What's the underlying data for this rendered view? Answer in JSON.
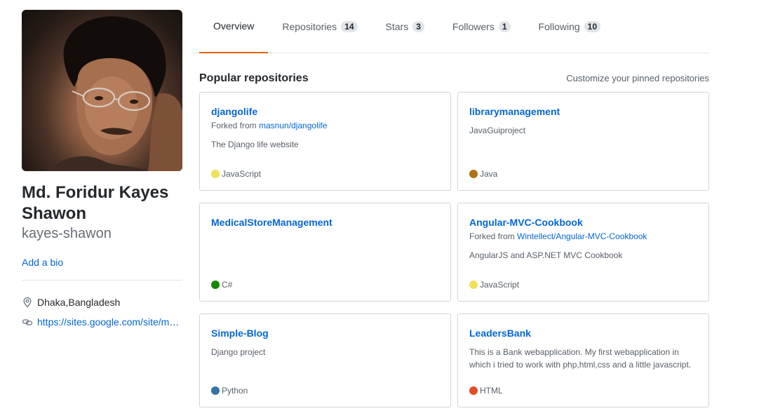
{
  "profile": {
    "name": "Md. Foridur Kayes Shawon",
    "login": "kayes-shawon",
    "add_bio": "Add a bio",
    "location": "Dhaka,Bangladesh",
    "website": "https://sites.google.com/site/m…"
  },
  "tabs": [
    {
      "label": "Overview",
      "count": null,
      "selected": true
    },
    {
      "label": "Repositories",
      "count": "14",
      "selected": false
    },
    {
      "label": "Stars",
      "count": "3",
      "selected": false
    },
    {
      "label": "Followers",
      "count": "1",
      "selected": false
    },
    {
      "label": "Following",
      "count": "10",
      "selected": false
    }
  ],
  "popular": {
    "title": "Popular repositories",
    "customize": "Customize your pinned repositories"
  },
  "repos": [
    {
      "name": "djangolife",
      "forked_prefix": "Forked from ",
      "forked_from": "masnun/djangolife",
      "description": "The Django life website",
      "language": "JavaScript",
      "lang_color": "#f1e05a"
    },
    {
      "name": "librarymanagement",
      "forked_prefix": "",
      "forked_from": "",
      "description": "JavaGuiproject",
      "language": "Java",
      "lang_color": "#b07219"
    },
    {
      "name": "MedicalStoreManagement",
      "forked_prefix": "",
      "forked_from": "",
      "description": "",
      "language": "C#",
      "lang_color": "#178600"
    },
    {
      "name": "Angular-MVC-Cookbook",
      "forked_prefix": "Forked from ",
      "forked_from": "Wintellect/Angular-MVC-Cookbook",
      "description": "AngularJS and ASP.NET MVC Cookbook",
      "language": "JavaScript",
      "lang_color": "#f1e05a"
    },
    {
      "name": "Simple-Blog",
      "forked_prefix": "",
      "forked_from": "",
      "description": "Django project",
      "language": "Python",
      "lang_color": "#3572A5"
    },
    {
      "name": "LeadersBank",
      "forked_prefix": "",
      "forked_from": "",
      "description": "This is a Bank webapplication. My first webapplication in which i tried to work with php,html,css and a little javascript.",
      "language": "HTML",
      "lang_color": "#e34c26"
    }
  ],
  "icons": {
    "location": "location-pin-icon",
    "link": "link-icon"
  },
  "colors": {
    "link": "#0366d6",
    "tab_underline": "#e36209"
  }
}
